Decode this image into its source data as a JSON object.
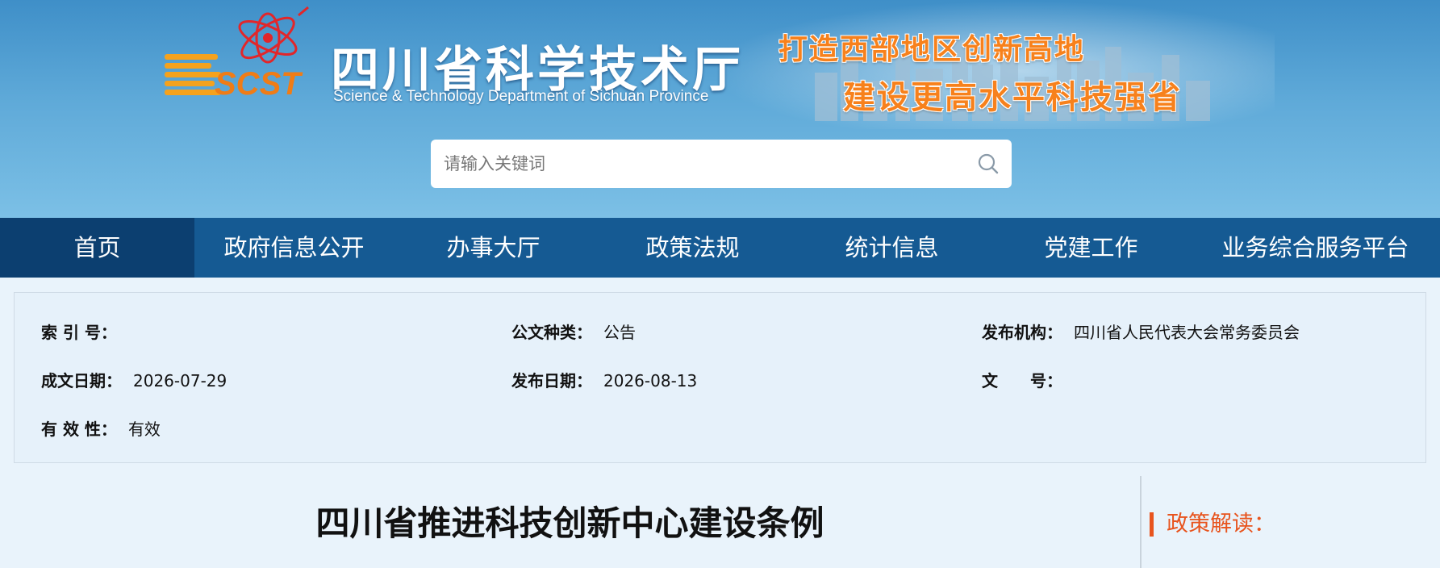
{
  "header": {
    "logo_text": "SCST",
    "site_title": "四川省科学技术厅",
    "site_subtitle": "Science & Technology Department of Sichuan Province",
    "slogan_line1": "打造西部地区创新高地",
    "slogan_line2": "建设更高水平科技强省"
  },
  "search": {
    "placeholder": "请输入关键词",
    "value": "",
    "icon": "search-icon"
  },
  "nav": {
    "items": [
      {
        "label": "首页",
        "active": true
      },
      {
        "label": "政府信息公开",
        "active": false
      },
      {
        "label": "办事大厅",
        "active": false
      },
      {
        "label": "政策法规",
        "active": false
      },
      {
        "label": "统计信息",
        "active": false
      },
      {
        "label": "党建工作",
        "active": false
      },
      {
        "label": "业务综合服务平台",
        "active": false
      }
    ]
  },
  "info": {
    "index_no": {
      "label": "索 引 号：",
      "value": ""
    },
    "doc_type": {
      "label": "公文种类：",
      "value": "公告"
    },
    "publisher": {
      "label": "发布机构：",
      "value": "四川省人民代表大会常务委员会"
    },
    "created_date": {
      "label": "成文日期：",
      "value": "2026-07-29"
    },
    "publish_date": {
      "label": "发布日期：",
      "value": "2026-08-13"
    },
    "doc_no": {
      "label": "文　　号：",
      "value": ""
    },
    "validity": {
      "label": "有 效 性：",
      "value": "有效"
    }
  },
  "article": {
    "title": "四川省推进科技创新中心建设条例"
  },
  "sidebar": {
    "heading": "政策解读："
  },
  "colors": {
    "nav_bg": "#155a93",
    "nav_active_bg": "#0c3f70",
    "accent_orange": "#e8541e",
    "panel_bg": "#e6f1fa"
  }
}
